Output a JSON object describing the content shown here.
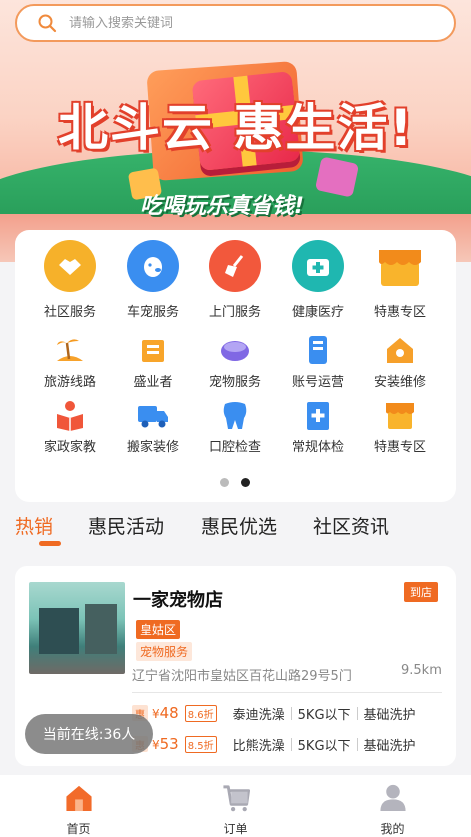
{
  "search": {
    "placeholder": "请输入搜索关键词"
  },
  "banner": {
    "title": "北斗云 惠生活!",
    "slogan": "吃喝玩乐真省钱!"
  },
  "services": [
    {
      "label": "社区服务",
      "icon": "handshake-icon",
      "color": "#f6a623"
    },
    {
      "label": "车宠服务",
      "icon": "dog-icon",
      "color": "#2f86e8"
    },
    {
      "label": "上门服务",
      "icon": "broom-icon",
      "color": "#f0563a"
    },
    {
      "label": "健康医疗",
      "icon": "medical-kit-icon",
      "color": "#1fb7b0"
    },
    {
      "label": "特惠专区",
      "icon": "storefront-icon",
      "color": "#f7a21f"
    },
    {
      "label": "旅游线路",
      "icon": "palm-beach-icon",
      "color": "#f59a20"
    },
    {
      "label": "盛业者",
      "icon": "price-tag-icon",
      "color": "#f59a20"
    },
    {
      "label": "宠物服务",
      "icon": "pet-bowl-icon",
      "color": "#7b5fe0"
    },
    {
      "label": "账号运营",
      "icon": "phone-account-icon",
      "color": "#2f86e8"
    },
    {
      "label": "安装维修",
      "icon": "wrench-house-icon",
      "color": "#f59a20"
    },
    {
      "label": "家政家教",
      "icon": "reading-person-icon",
      "color": "#f0563a"
    },
    {
      "label": "搬家装修",
      "icon": "truck-icon",
      "color": "#2f86e8"
    },
    {
      "label": "口腔检查",
      "icon": "tooth-icon",
      "color": "#2f86e8"
    },
    {
      "label": "常规体检",
      "icon": "clipboard-cross-icon",
      "color": "#2f86e8"
    },
    {
      "label": "特惠专区",
      "icon": "storefront-icon",
      "color": "#f7a21f"
    }
  ],
  "carousel": {
    "page": 2,
    "total": 2
  },
  "tabs": [
    {
      "label": "热销",
      "active": true
    },
    {
      "label": "惠民活动",
      "active": false
    },
    {
      "label": "惠民优选",
      "active": false
    },
    {
      "label": "社区资讯",
      "active": false
    }
  ],
  "store": {
    "name": "一家宠物店",
    "badge": "到店",
    "district": "皇姑区",
    "category": "宠物服务",
    "address": "辽宁省沈阳市皇姑区百花山路29号5门",
    "distance": "9.5km",
    "deals": [
      {
        "tag": "惠",
        "currency": "¥",
        "price": "48",
        "discount": "8.6折",
        "name": "泰迪洗澡",
        "weight": "5KG以下",
        "type": "基础洗护"
      },
      {
        "tag": "惠",
        "currency": "¥",
        "price": "53",
        "discount": "8.5折",
        "name": "比熊洗澡",
        "weight": "5KG以下",
        "type": "基础洗护"
      }
    ]
  },
  "online": {
    "text": "当前在线:36人"
  },
  "bottom_nav": [
    {
      "label": "首页",
      "icon": "home-icon",
      "active": true
    },
    {
      "label": "订单",
      "icon": "cart-icon",
      "active": false
    },
    {
      "label": "我的",
      "icon": "user-icon",
      "active": false
    }
  ],
  "colors": {
    "accent": "#ef6a22",
    "search_border": "#f39a5c"
  }
}
